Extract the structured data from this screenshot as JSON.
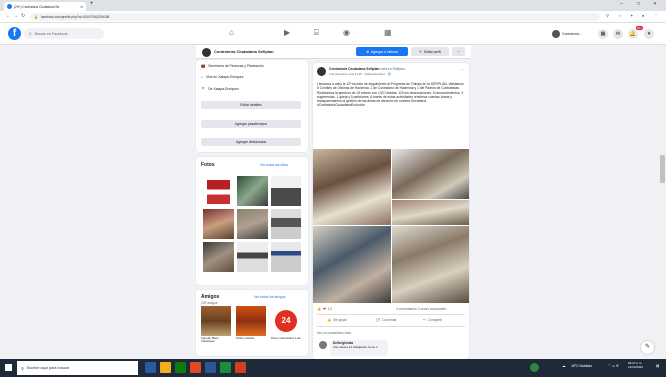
{
  "browser": {
    "tab_title": "(20+) Contraloría Ciudadana Se",
    "new_tab": "+",
    "url": "facebook.com/profile.php?id=100079162294158",
    "win_min": "–",
    "win_max": "□",
    "win_close": "✕"
  },
  "fb": {
    "logo": "f",
    "search_placeholder": "Buscar en Facebook",
    "profile_name": "Contraloría...",
    "badge": "20+"
  },
  "profile_bar": {
    "name": "Contraloría Ciudadana Sefiplan",
    "add_story": "Agregar a historia",
    "edit_profile": "Editar perfil",
    "more": "···"
  },
  "intro": {
    "items": [
      "Secretaría de Finanzas y Planeación",
      "Vive en Xalapa-Enríquez",
      "De Xalapa-Enríquez"
    ],
    "edit_details": "Editar detalles",
    "add_hobbies": "Agregar pasatiempos",
    "add_featured": "Agregar destacados"
  },
  "photos": {
    "title": "Fotos",
    "see_all": "Ver todas las fotos"
  },
  "friends": {
    "title": "Amigos",
    "count": "229 amigos",
    "see_all": "Ver todos los amigos",
    "list": [
      {
        "name": "Agustín Baez Velázquez"
      },
      {
        "name": "Pedro Carrillo"
      },
      {
        "name": "Pérez Hernández Luis"
      }
    ]
  },
  "post": {
    "author": "Contraloría Ciudadana Sefiplan",
    "action": "está en Sefiplan.",
    "meta": "4 de diciembre a las 14:35 · Xalapa-Enríquez · 🌐",
    "text": "Llevamos a cabo la 12ª reunión de seguimiento al Programa de Trabajo en la SEFIPLAN. Validamos 5 Comités de Oficinas de Hacienda, 1 de Contraloría de Hacienda y 1 del Padrón de Contratistas. Realizamos la apertura de 15 sobres con 133 Cédulas: 119 sin observaciones, 5 reconocimientos, 4 sugerencias, 1 queja y 5 peticiones. A través de estas actividades rendimos cuentas claras y transparentamos la gestión de las áreas de atención de nuestra Secretaría #ContraloríaCiudadanaEnAcción",
    "reactions_count": "13",
    "stats": "4 comentarios  3 veces compartido",
    "like": "Me gusta",
    "comment": "Comentar",
    "share": "Compartir",
    "more_comments": "Ver un comentario más",
    "commenter": "Delia Iglesias",
    "comment_text": "Atte saluos 14 trabajando como s"
  },
  "taskbar": {
    "search_placeholder": "Escribe aquí para buscar",
    "weather": "18°C Nublado",
    "time": "09:47 p.m.",
    "date": "12/12/2022"
  },
  "colors": {
    "fb_blue": "#1877f2",
    "taskbar": "#1f2a38"
  }
}
